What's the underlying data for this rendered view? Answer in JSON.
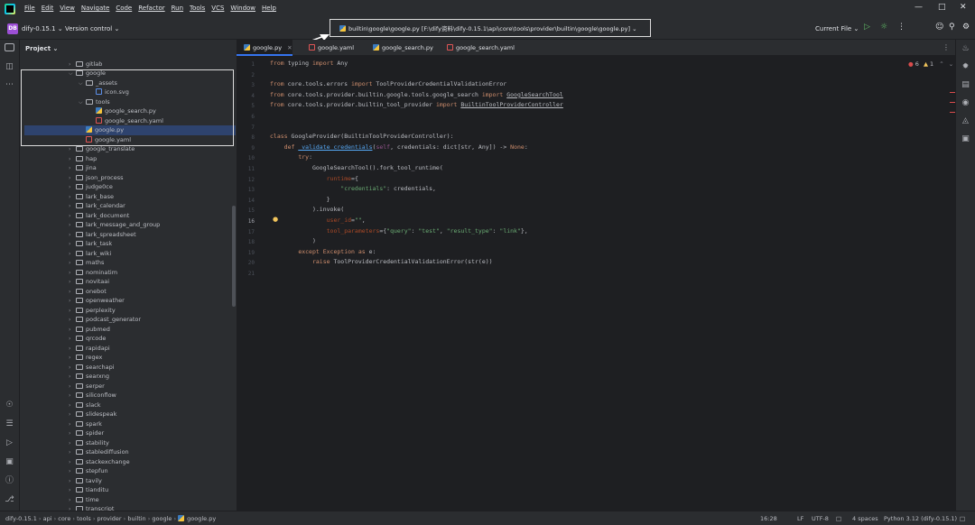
{
  "menu": [
    "File",
    "Edit",
    "View",
    "Navigate",
    "Code",
    "Refactor",
    "Run",
    "Tools",
    "VCS",
    "Window",
    "Help"
  ],
  "toolbar": {
    "project_badge": "DB",
    "project_name": "dify-0.15.1",
    "vcs": "Version control",
    "breadcrumb": "builtin\\google\\google.py [F:\\dify资料\\dify-0.15.1\\api\\core\\tools\\provider\\builtin\\google\\google.py]",
    "run_config": "Current File"
  },
  "project_panel": {
    "header": "Project",
    "tree": [
      {
        "label": "gitlab",
        "level": 0,
        "kind": "folder",
        "expanded": false
      },
      {
        "label": "google",
        "level": 0,
        "kind": "folder",
        "expanded": true
      },
      {
        "label": "_assets",
        "level": 1,
        "kind": "folder",
        "expanded": true
      },
      {
        "label": "icon.svg",
        "level": 2,
        "kind": "svg"
      },
      {
        "label": "tools",
        "level": 1,
        "kind": "folder",
        "expanded": true
      },
      {
        "label": "google_search.py",
        "level": 2,
        "kind": "py"
      },
      {
        "label": "google_search.yaml",
        "level": 2,
        "kind": "yaml"
      },
      {
        "label": "google.py",
        "level": 1,
        "kind": "py",
        "selected": true
      },
      {
        "label": "google.yaml",
        "level": 1,
        "kind": "yaml"
      },
      {
        "label": "google_translate",
        "level": 0,
        "kind": "folder"
      },
      {
        "label": "hap",
        "level": 0,
        "kind": "folder"
      },
      {
        "label": "jina",
        "level": 0,
        "kind": "folder"
      },
      {
        "label": "json_process",
        "level": 0,
        "kind": "folder"
      },
      {
        "label": "judge0ce",
        "level": 0,
        "kind": "folder"
      },
      {
        "label": "lark_base",
        "level": 0,
        "kind": "folder"
      },
      {
        "label": "lark_calendar",
        "level": 0,
        "kind": "folder"
      },
      {
        "label": "lark_document",
        "level": 0,
        "kind": "folder"
      },
      {
        "label": "lark_message_and_group",
        "level": 0,
        "kind": "folder"
      },
      {
        "label": "lark_spreadsheet",
        "level": 0,
        "kind": "folder"
      },
      {
        "label": "lark_task",
        "level": 0,
        "kind": "folder"
      },
      {
        "label": "lark_wiki",
        "level": 0,
        "kind": "folder"
      },
      {
        "label": "maths",
        "level": 0,
        "kind": "folder"
      },
      {
        "label": "nominatim",
        "level": 0,
        "kind": "folder"
      },
      {
        "label": "novitaai",
        "level": 0,
        "kind": "folder"
      },
      {
        "label": "onebot",
        "level": 0,
        "kind": "folder"
      },
      {
        "label": "openweather",
        "level": 0,
        "kind": "folder"
      },
      {
        "label": "perplexity",
        "level": 0,
        "kind": "folder"
      },
      {
        "label": "podcast_generator",
        "level": 0,
        "kind": "folder"
      },
      {
        "label": "pubmed",
        "level": 0,
        "kind": "folder"
      },
      {
        "label": "qrcode",
        "level": 0,
        "kind": "folder"
      },
      {
        "label": "rapidapi",
        "level": 0,
        "kind": "folder"
      },
      {
        "label": "regex",
        "level": 0,
        "kind": "folder"
      },
      {
        "label": "searchapi",
        "level": 0,
        "kind": "folder"
      },
      {
        "label": "searxng",
        "level": 0,
        "kind": "folder"
      },
      {
        "label": "serper",
        "level": 0,
        "kind": "folder"
      },
      {
        "label": "siliconflow",
        "level": 0,
        "kind": "folder"
      },
      {
        "label": "slack",
        "level": 0,
        "kind": "folder"
      },
      {
        "label": "slidespeak",
        "level": 0,
        "kind": "folder"
      },
      {
        "label": "spark",
        "level": 0,
        "kind": "folder"
      },
      {
        "label": "spider",
        "level": 0,
        "kind": "folder"
      },
      {
        "label": "stability",
        "level": 0,
        "kind": "folder"
      },
      {
        "label": "stablediffusion",
        "level": 0,
        "kind": "folder"
      },
      {
        "label": "stackexchange",
        "level": 0,
        "kind": "folder"
      },
      {
        "label": "stepfun",
        "level": 0,
        "kind": "folder"
      },
      {
        "label": "tavily",
        "level": 0,
        "kind": "folder"
      },
      {
        "label": "tianditu",
        "level": 0,
        "kind": "folder"
      },
      {
        "label": "time",
        "level": 0,
        "kind": "folder"
      },
      {
        "label": "transcript",
        "level": 0,
        "kind": "folder"
      }
    ]
  },
  "tabs": [
    {
      "label": "google.py",
      "kind": "py",
      "active": true
    },
    {
      "label": "google.yaml",
      "kind": "yaml"
    },
    {
      "label": "google_search.py",
      "kind": "py"
    },
    {
      "label": "google_search.yaml",
      "kind": "yaml"
    }
  ],
  "inspections": {
    "errors": "6",
    "warnings": "1"
  },
  "editor": {
    "current_line": 16,
    "lines": [
      {
        "n": 1,
        "html": "<span class='kw'>from</span> typing <span class='kw'>import</span> Any"
      },
      {
        "n": 2,
        "html": ""
      },
      {
        "n": 3,
        "html": "<span class='kw'>from</span> core.tools.errors <span class='kw'>import</span> ToolProviderCredentialValidationError"
      },
      {
        "n": 4,
        "html": "<span class='kw'>from</span> core.tools.provider.builtin.google.tools.google_search <span class='kw'>import</span> <span class='und'>GoogleSearchTool</span>"
      },
      {
        "n": 5,
        "html": "<span class='kw'>from</span> core.tools.provider.builtin_tool_provider <span class='kw'>import</span> <span class='und'>BuiltinToolProviderController</span>"
      },
      {
        "n": 6,
        "html": ""
      },
      {
        "n": 7,
        "html": ""
      },
      {
        "n": 8,
        "html": "<span class='kw'>class</span> GoogleProvider(BuiltinToolProviderController):"
      },
      {
        "n": 9,
        "html": "    <span class='kw'>def</span> <span class='fn und'>_validate_credentials</span>(<span class='self'>self</span>, credentials: dict[str, Any]) -> <span class='kw'>None</span>:"
      },
      {
        "n": 10,
        "html": "        <span class='kw'>try</span>:"
      },
      {
        "n": 11,
        "html": "            GoogleSearchTool().fork_tool_runtime("
      },
      {
        "n": 12,
        "html": "                <span class='param'>runtime</span>={"
      },
      {
        "n": 13,
        "html": "                    <span class='str'>\"credentials\"</span>: credentials,"
      },
      {
        "n": 14,
        "html": "                }"
      },
      {
        "n": 15,
        "html": "            ).invoke("
      },
      {
        "n": 16,
        "html": "                <span class='param'>user_id</span>=<span class='str'>\"\"</span>,"
      },
      {
        "n": 17,
        "html": "                <span class='param'>tool_parameters</span>={<span class='str'>\"query\"</span>: <span class='str'>\"test\"</span>, <span class='str'>\"result_type\"</span>: <span class='str'>\"link\"</span>},"
      },
      {
        "n": 18,
        "html": "            )"
      },
      {
        "n": 19,
        "html": "        <span class='kw'>except</span> <span class='kw'>Exception</span> <span class='kw'>as</span> e:"
      },
      {
        "n": 20,
        "html": "            <span class='kw'>raise</span> ToolProviderCredentialValidationError(str(e))"
      },
      {
        "n": 21,
        "html": ""
      }
    ]
  },
  "status": {
    "path": [
      "dify-0.15.1",
      "api",
      "core",
      "tools",
      "provider",
      "builtin",
      "google",
      "google.py"
    ],
    "position": "16:28",
    "line_ending": "LF",
    "encoding": "UTF-8",
    "indent": "4 spaces",
    "interpreter": "Python 3.12 (dify-0.15.1)"
  },
  "colors": {
    "accent": "#3574f0",
    "selection": "#2e436e",
    "error": "#d94c4c"
  }
}
